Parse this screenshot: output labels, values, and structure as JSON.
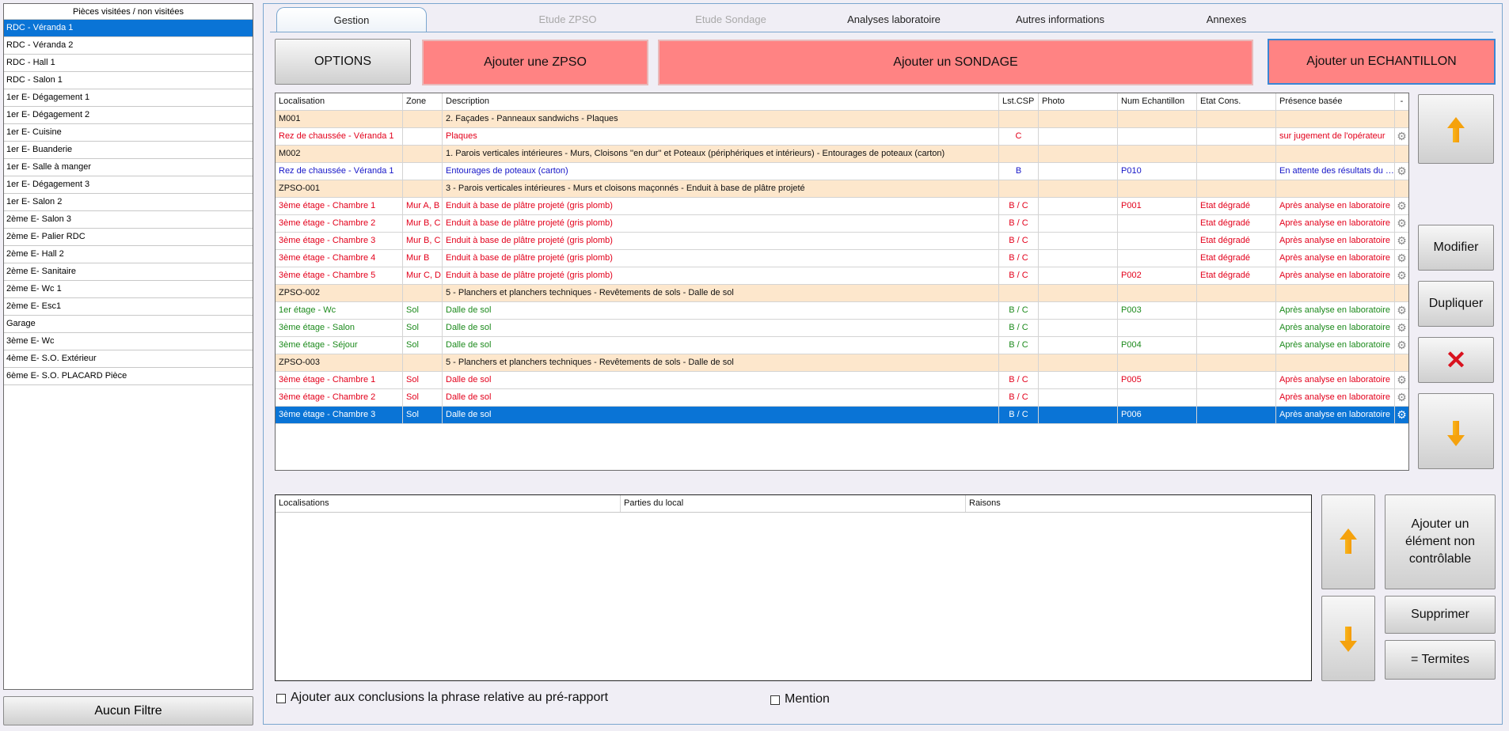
{
  "left_panel": {
    "header": "Pièces visitées / non visitées",
    "rooms": [
      "RDC - Véranda 1",
      "RDC - Véranda 2",
      "RDC - Hall 1",
      "RDC - Salon 1",
      "1er E- Dégagement 1",
      "1er E- Dégagement 2",
      "1er E- Cuisine",
      "1er E- Buanderie",
      "1er E- Salle à manger",
      "1er E- Dégagement 3",
      "1er E- Salon 2",
      "2ème E- Salon 3",
      "2ème E- Palier RDC",
      "2ème E- Hall 2",
      "2ème E- Sanitaire",
      "2ème E- Wc 1",
      "2ème E- Esc1",
      "Garage",
      "3ème E- Wc",
      "4ème E- S.O. Extérieur",
      "6ème E- S.O. PLACARD Pièce"
    ],
    "selected_room": "RDC - Véranda 1",
    "filter_label": "Aucun Filtre"
  },
  "tabs": [
    {
      "label": "Gestion",
      "state": "active"
    },
    {
      "label": "Etude ZPSO",
      "state": "disabled"
    },
    {
      "label": "Etude Sondage",
      "state": "disabled"
    },
    {
      "label": "Analyses laboratoire",
      "state": "normal"
    },
    {
      "label": "Autres informations",
      "state": "normal"
    },
    {
      "label": "Annexes",
      "state": "normal"
    }
  ],
  "toolbar": {
    "options": "OPTIONS",
    "add_zpso": "Ajouter une ZPSO",
    "add_sondage": "Ajouter un SONDAGE",
    "add_echantillon": "Ajouter un ECHANTILLON",
    "accent_red": "#ff8383"
  },
  "main_table": {
    "columns": [
      "Localisation",
      "Zone",
      "Description",
      "Lst.CSP",
      "Photo",
      "Num Echantillon",
      "Etat Cons.",
      "Présence basée",
      "-"
    ],
    "rows": [
      {
        "kind": "group",
        "loc": "M001",
        "desc": "2. Façades - Panneaux sandwichs - Plaques"
      },
      {
        "kind": "item",
        "color": "red",
        "loc": "Rez de chaussée - Véranda 1",
        "zone": "",
        "desc": "Plaques",
        "csp": "C",
        "photo": "",
        "ech": "",
        "etat": "",
        "pres": "sur jugement de l'opérateur"
      },
      {
        "kind": "group",
        "loc": "M002",
        "desc": "1. Parois verticales intérieures - Murs, Cloisons ''en dur'' et Poteaux (périphériques et intérieurs) - Entourages de poteaux (carton)"
      },
      {
        "kind": "item",
        "color": "blue",
        "loc": "Rez de chaussée - Véranda 1",
        "zone": "",
        "desc": "Entourages de poteaux (carton)",
        "csp": "B",
        "photo": "",
        "ech": "P010",
        "etat": "",
        "pres": "En attente des résultats du laboratoire"
      },
      {
        "kind": "group",
        "loc": "ZPSO-001",
        "desc": "3 - Parois verticales intérieures - Murs et cloisons maçonnés - Enduit à base de plâtre projeté"
      },
      {
        "kind": "item",
        "color": "red",
        "loc": "3ème étage - Chambre 1",
        "zone": "Mur A, B",
        "desc": "Enduit à base de plâtre projeté (gris plomb)",
        "csp": "B / C",
        "photo": "",
        "ech": "P001",
        "etat": "Etat dégradé",
        "pres": "Après analyse en laboratoire"
      },
      {
        "kind": "item",
        "color": "red",
        "loc": "3ème étage - Chambre 2",
        "zone": "Mur B, C",
        "desc": "Enduit à base de plâtre projeté (gris plomb)",
        "csp": "B / C",
        "photo": "",
        "ech": "",
        "etat": "Etat dégradé",
        "pres": "Après analyse en laboratoire"
      },
      {
        "kind": "item",
        "color": "red",
        "loc": "3ème étage - Chambre 3",
        "zone": "Mur B, C",
        "desc": "Enduit à base de plâtre projeté (gris plomb)",
        "csp": "B / C",
        "photo": "",
        "ech": "",
        "etat": "Etat dégradé",
        "pres": "Après analyse en laboratoire"
      },
      {
        "kind": "item",
        "color": "red",
        "loc": "3ème étage - Chambre 4",
        "zone": "Mur B",
        "desc": "Enduit à base de plâtre projeté (gris plomb)",
        "csp": "B / C",
        "photo": "",
        "ech": "",
        "etat": "Etat dégradé",
        "pres": "Après analyse en laboratoire"
      },
      {
        "kind": "item",
        "color": "red",
        "loc": "3ème étage - Chambre 5",
        "zone": "Mur C, D",
        "desc": "Enduit à base de plâtre projeté (gris plomb)",
        "csp": "B / C",
        "photo": "",
        "ech": "P002",
        "etat": "Etat dégradé",
        "pres": "Après analyse en laboratoire"
      },
      {
        "kind": "group",
        "loc": "ZPSO-002",
        "desc": "5 - Planchers et planchers techniques - Revêtements de sols - Dalle de sol"
      },
      {
        "kind": "item",
        "color": "green",
        "loc": "1er étage - Wc",
        "zone": "Sol",
        "desc": "Dalle de sol",
        "csp": "B / C",
        "photo": "",
        "ech": "P003",
        "etat": "",
        "pres": "Après analyse en laboratoire"
      },
      {
        "kind": "item",
        "color": "green",
        "loc": "3ème étage - Salon",
        "zone": "Sol",
        "desc": "Dalle de sol",
        "csp": "B / C",
        "photo": "",
        "ech": "",
        "etat": "",
        "pres": "Après analyse en laboratoire"
      },
      {
        "kind": "item",
        "color": "green",
        "loc": "3ème étage - Séjour",
        "zone": "Sol",
        "desc": "Dalle de sol",
        "csp": "B / C",
        "photo": "",
        "ech": "P004",
        "etat": "",
        "pres": "Après analyse en laboratoire"
      },
      {
        "kind": "group",
        "loc": "ZPSO-003",
        "desc": "5 - Planchers et planchers techniques - Revêtements de sols - Dalle de sol"
      },
      {
        "kind": "item",
        "color": "red",
        "loc": "3ème étage - Chambre 1",
        "zone": "Sol",
        "desc": "Dalle de sol",
        "csp": "B / C",
        "photo": "",
        "ech": "P005",
        "etat": "",
        "pres": "Après analyse en laboratoire"
      },
      {
        "kind": "item",
        "color": "red",
        "loc": "3ème étage - Chambre 2",
        "zone": "Sol",
        "desc": "Dalle de sol",
        "csp": "B / C",
        "photo": "",
        "ech": "",
        "etat": "",
        "pres": "Après analyse en laboratoire"
      },
      {
        "kind": "item",
        "color": "sel",
        "loc": "3ème étage - Chambre 3",
        "zone": "Sol",
        "desc": "Dalle de sol",
        "csp": "B / C",
        "photo": "",
        "ech": "P006",
        "etat": "",
        "pres": "Après analyse en laboratoire"
      }
    ]
  },
  "right_buttons": {
    "modify": "Modifier",
    "duplicate": "Dupliquer"
  },
  "sub_table": {
    "columns": [
      "Localisations",
      "Parties du local",
      "Raisons"
    ]
  },
  "sub_buttons": {
    "add_non_controllable": "Ajouter un élément non contrôlable",
    "delete": "Supprimer",
    "termites": "= Termites"
  },
  "checkboxes": {
    "pre_report": "Ajouter aux conclusions la phrase relative au pré-rapport",
    "mention": "Mention"
  }
}
